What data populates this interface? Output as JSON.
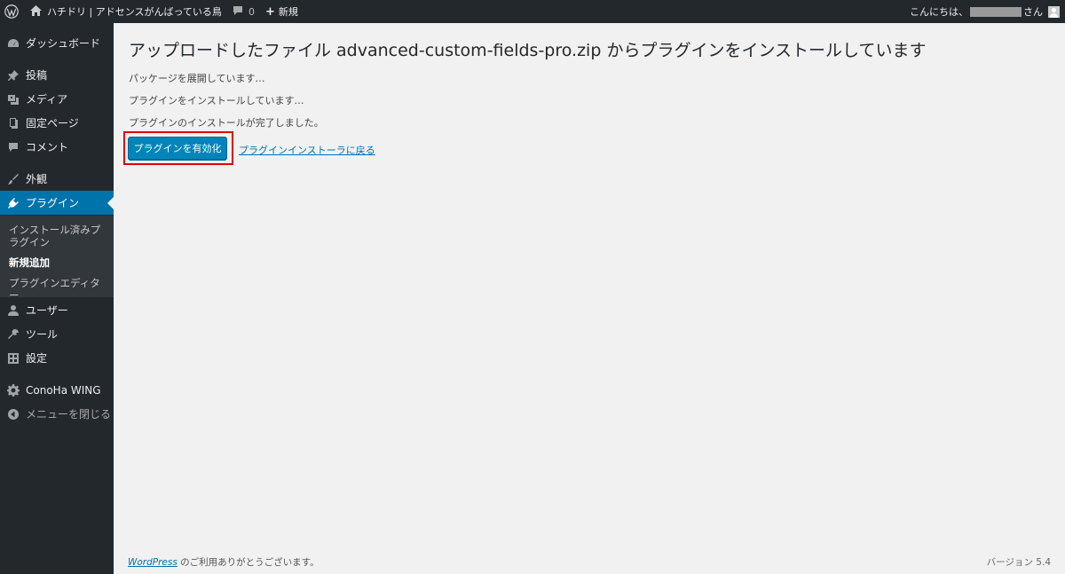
{
  "admin_bar": {
    "site_name": "ハチドリ | アドセンスがんばっている鳥",
    "comments_count": "0",
    "new_label": "新規",
    "greeting_prefix": "こんにちは、",
    "greeting_suffix": "さん"
  },
  "sidebar": {
    "items": [
      {
        "label": "ダッシュボード",
        "icon": "dashboard-icon"
      },
      {
        "label": "投稿",
        "icon": "pin-icon"
      },
      {
        "label": "メディア",
        "icon": "media-icon"
      },
      {
        "label": "固定ページ",
        "icon": "page-icon"
      },
      {
        "label": "コメント",
        "icon": "comment-icon"
      },
      {
        "label": "外観",
        "icon": "brush-icon"
      },
      {
        "label": "プラグイン",
        "icon": "plugin-icon"
      },
      {
        "label": "ユーザー",
        "icon": "user-icon"
      },
      {
        "label": "ツール",
        "icon": "wrench-icon"
      },
      {
        "label": "設定",
        "icon": "settings-icon"
      },
      {
        "label": "ConoHa WING",
        "icon": "gear-icon"
      },
      {
        "label": "メニューを閉じる",
        "icon": "collapse-icon"
      }
    ],
    "submenu": [
      {
        "label": "インストール済みプラグイン"
      },
      {
        "label": "新規追加"
      },
      {
        "label": "プラグインエディター"
      }
    ]
  },
  "main": {
    "title": "アップロードしたファイル advanced-custom-fields-pro.zip からプラグインをインストールしています",
    "messages": [
      "パッケージを展開しています…",
      "プラグインをインストールしています…",
      "プラグインのインストールが完了しました。"
    ],
    "activate_button": "プラグインを有効化",
    "return_link": "プラグインインストーラに戻る"
  },
  "footer": {
    "wp_link": "WordPress",
    "thanks": " のご利用ありがとうございます。",
    "version": "バージョン 5.4"
  },
  "colors": {
    "admin_bg": "#23282d",
    "accent": "#0073aa",
    "button": "#0085ba",
    "highlight_border": "#e00000"
  }
}
